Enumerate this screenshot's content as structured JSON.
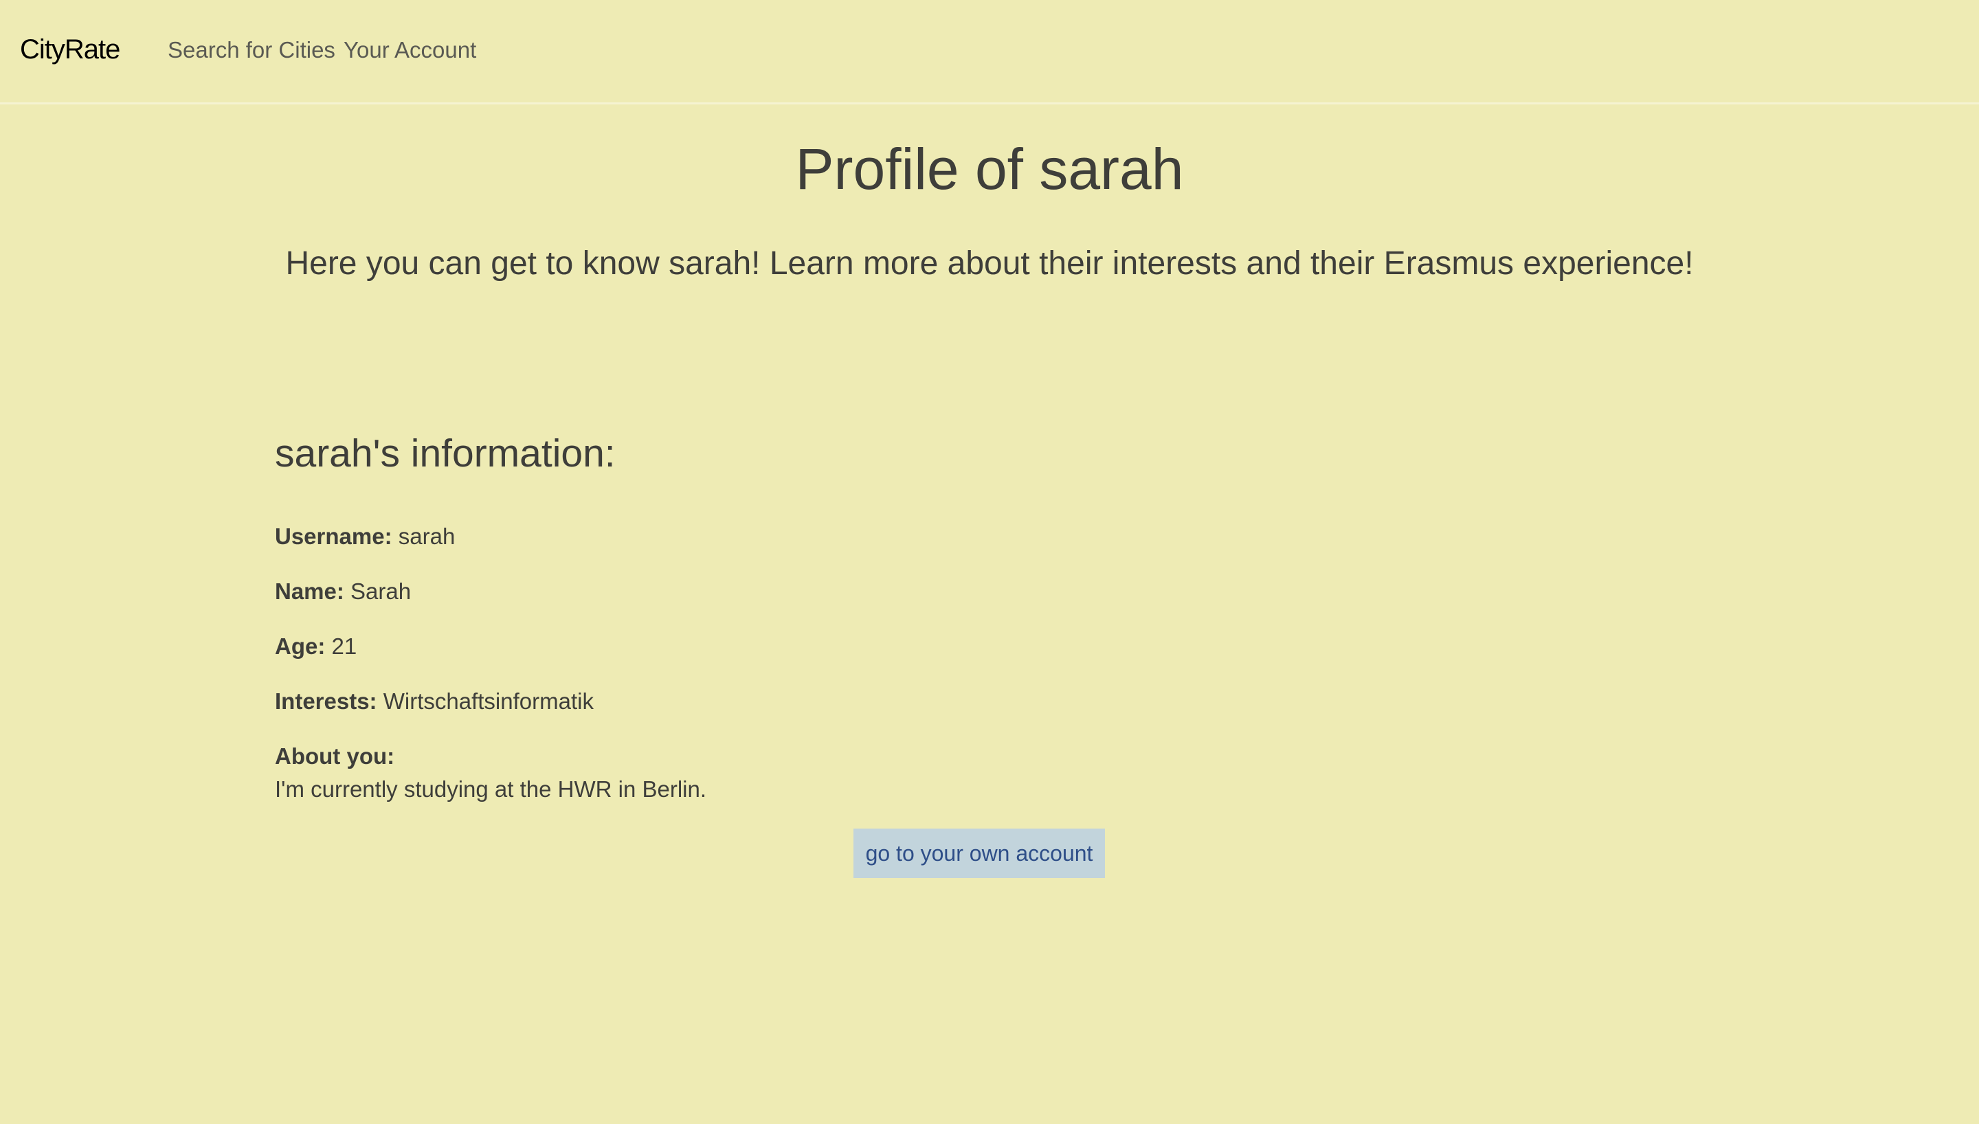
{
  "navbar": {
    "brand": "CityRate",
    "links": [
      {
        "label": "Search for Cities"
      },
      {
        "label": "Your Account"
      }
    ]
  },
  "page": {
    "title": "Profile of sarah",
    "subtitle": "Here you can get to know sarah! Learn more about their interests and their Erasmus experience!"
  },
  "profile": {
    "heading": "sarah's information:",
    "fields": [
      {
        "label": "Username:",
        "value": "sarah"
      },
      {
        "label": "Name:",
        "value": "Sarah"
      },
      {
        "label": "Age:",
        "value": "21"
      },
      {
        "label": "Interests:",
        "value": "Wirtschaftsinformatik"
      }
    ],
    "about_label": "About you:",
    "about_text": "I'm currently studying at the HWR in Berlin."
  },
  "actions": {
    "own_account_label": "go to your own account"
  },
  "colors": {
    "background": "#eeebb4",
    "text": "#3e3e3a",
    "button_background": "#c2d4dc",
    "button_text": "#2e4e88"
  }
}
